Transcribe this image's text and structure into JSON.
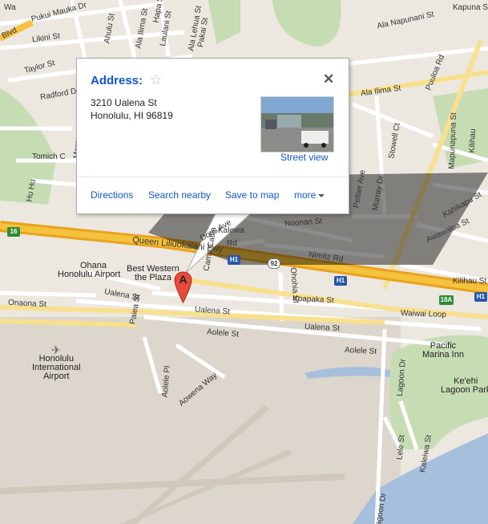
{
  "info_window": {
    "title": "Address:",
    "address_line1": "3210 Ualena St",
    "address_line2": "Honolulu, HI 96819",
    "street_view_link": "Street view",
    "actions": {
      "directions": "Directions",
      "search_nearby": "Search nearby",
      "save_to_map": "Save to map",
      "more": "more"
    }
  },
  "marker": {
    "letter": "A"
  },
  "colors": {
    "link": "#1155cc",
    "highway": "#f2b21f",
    "water": "#a5bfdd",
    "park": "#c6dcb3"
  },
  "street_labels": {
    "waiwai_pukui_mauka": "Pukui Mauka Dr",
    "waiwai_top": "Wa",
    "ahulu": "Ahulu St",
    "ala_ilima_top": "Ala Ilima St",
    "laulani": "Laulani St",
    "lehua": "Ala Lehua St",
    "pakai": "Pakai St",
    "hapa": "Hapa St",
    "napunani": "Ala Napunani St",
    "kapuna": "Kapuna St",
    "likini": "Likini St",
    "taylor": "Taylor St",
    "radford": "Radford Dr",
    "puuloa": "Puuloa Rd",
    "ala_ilima": "Ala Ilima St",
    "mapunapuna": "Mapunapuna St",
    "kilihau_top": "Kilihau",
    "stowell": "Stowell Ct",
    "moreno": "Moreno",
    "tomich": "Tomich C",
    "peltier": "Peltier Ave",
    "murray": "Murray Dr",
    "lauwiliwili": "Lauwiliwili",
    "kahikapu": "Kahikapu St",
    "awawaloa": "Awawaloa St",
    "hu_hu": "Hu Hu",
    "camp_catlin": "Camp Catlin",
    "doris": "Doris Ave",
    "kalewa": "Kalewa",
    "rd": "Rd",
    "noonan": "Noonan St",
    "nimitz": "Nimitz Rd",
    "kilihau": "Kilihau St",
    "freeway": "Queen Liliuokalani Fwy",
    "ohana": "Ohana",
    "honolulu_airport": "Honolulu Airport",
    "best_western": "Best Western\nthe Plaza",
    "ohohia": "Ohohia St",
    "koapaka": "Koapaka St",
    "ualena_left": "Ualena St",
    "ualena_mid": "Ualena St",
    "ualena_right": "Ualena St",
    "waiwai_loop": "Waiwai Loop",
    "onaona": "Onaona St",
    "paiea": "Paiea St",
    "aolele_left": "Aolele St",
    "aolele_right": "Aolele St",
    "aolele_pl": "Aolele Pl",
    "aowena": "Aowena Way",
    "pacific_marina": "Pacific\nMarina Inn",
    "ke_ehi": "Ke'ehi\nLagoon Park",
    "intl_airport": "Honolulu\nInternational\nAirport",
    "lagoon_dr_top": "Lagoon Dr",
    "lagoon_dr_bottom": "Lagoon Dr",
    "lele": "Lele St",
    "kaleiwa": "Kaleiwa St",
    "blvd": "Blvd"
  },
  "shields": {
    "h1_a": "H1",
    "h1_b": "H1",
    "h1_c": "H1",
    "r16": "16",
    "r92": "92",
    "r18a": "18A"
  }
}
